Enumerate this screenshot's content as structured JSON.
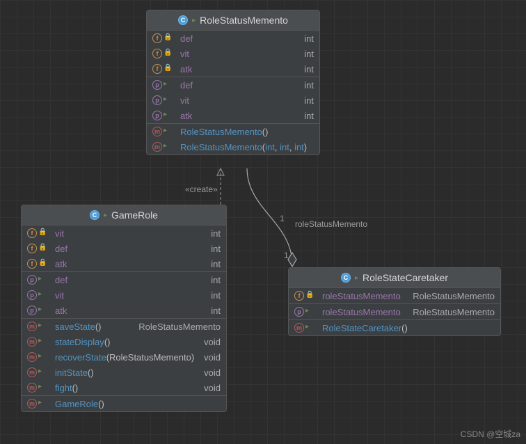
{
  "classes": {
    "memento": {
      "title": "RoleStatusMemento",
      "fields_private": [
        {
          "name": "def",
          "type": "int"
        },
        {
          "name": "vit",
          "type": "int"
        },
        {
          "name": "atk",
          "type": "int"
        }
      ],
      "properties": [
        {
          "name": "def",
          "type": "int"
        },
        {
          "name": "vit",
          "type": "int"
        },
        {
          "name": "atk",
          "type": "int"
        }
      ],
      "methods": [
        {
          "name": "RoleStatusMemento",
          "params": "()",
          "ret": ""
        },
        {
          "name": "RoleStatusMemento",
          "params_custom": [
            "int",
            "int",
            "int"
          ],
          "ret": ""
        }
      ]
    },
    "gamerole": {
      "title": "GameRole",
      "fields_private": [
        {
          "name": "vit",
          "type": "int"
        },
        {
          "name": "def",
          "type": "int"
        },
        {
          "name": "atk",
          "type": "int"
        }
      ],
      "properties": [
        {
          "name": "def",
          "type": "int"
        },
        {
          "name": "vit",
          "type": "int"
        },
        {
          "name": "atk",
          "type": "int"
        }
      ],
      "methods": [
        {
          "name": "saveState",
          "params": "()",
          "ret": "RoleStatusMemento"
        },
        {
          "name": "stateDisplay",
          "params": "()",
          "ret": "void"
        },
        {
          "name": "recoverState",
          "params": "(RoleStatusMemento)",
          "ret": "void"
        },
        {
          "name": "initState",
          "params": "()",
          "ret": "void"
        },
        {
          "name": "fight",
          "params": "()",
          "ret": "void"
        }
      ],
      "ctors": [
        {
          "name": "GameRole",
          "params": "()"
        }
      ]
    },
    "caretaker": {
      "title": "RoleStateCaretaker",
      "fields_private": [
        {
          "name": "roleStatusMemento",
          "type": "RoleStatusMemento"
        }
      ],
      "properties": [
        {
          "name": "roleStatusMemento",
          "type": "RoleStatusMemento"
        }
      ],
      "methods": [
        {
          "name": "RoleStateCaretaker",
          "params": "()",
          "ret": ""
        }
      ]
    }
  },
  "labels": {
    "create": "«create»",
    "assoc_name": "roleStatusMemento",
    "one_top": "1",
    "one_bottom": "1"
  },
  "watermark": "CSDN @空城za"
}
